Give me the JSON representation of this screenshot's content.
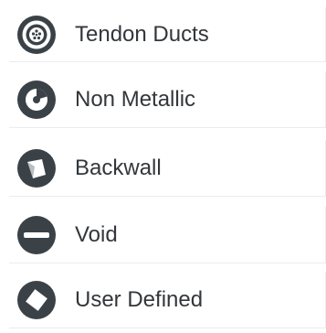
{
  "colors": {
    "icon": "#3b4247",
    "text": "#33363a",
    "divider": "#e9ecef"
  },
  "items": [
    {
      "label": "Tendon Ducts",
      "icon": "tendon-ducts-icon"
    },
    {
      "label": "Non Metallic",
      "icon": "non-metallic-icon"
    },
    {
      "label": "Backwall",
      "icon": "backwall-icon"
    },
    {
      "label": "Void",
      "icon": "void-icon"
    },
    {
      "label": "User Defined",
      "icon": "user-defined-icon"
    }
  ]
}
